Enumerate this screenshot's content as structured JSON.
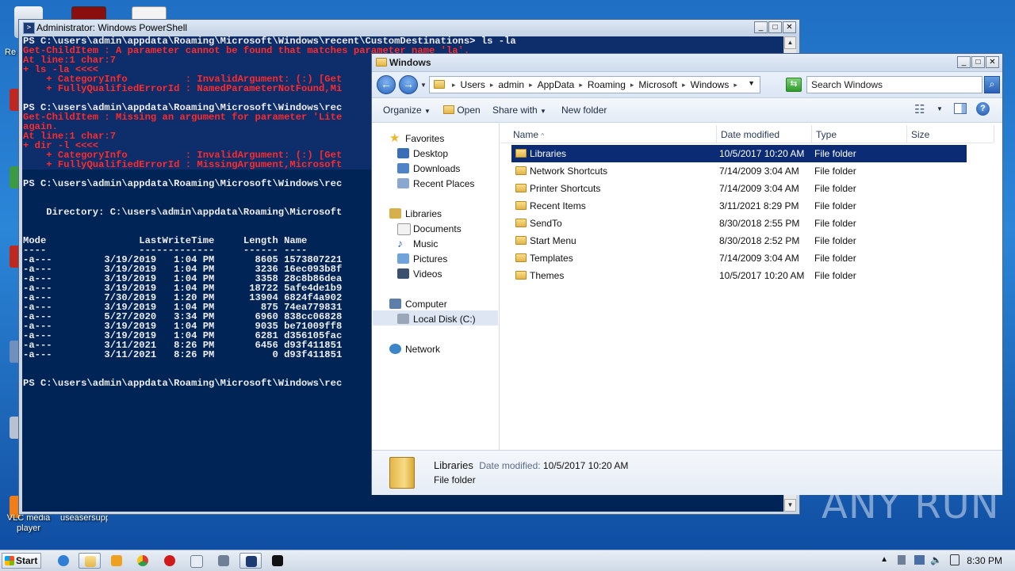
{
  "desktop": {
    "icons": [
      {
        "label": "Re"
      },
      {
        "label": "VLC media player"
      },
      {
        "label": "useasersuppor"
      }
    ],
    "watermark": "ANY RUN"
  },
  "powershell": {
    "title": "Administrator: Windows PowerShell",
    "lines": [
      {
        "text": "PS C:\\users\\admin\\appdata\\Roaming\\Microsoft\\Windows\\recent\\CustomDestinations> ls -la",
        "style": "sel"
      },
      {
        "text": "Get-ChildItem : A parameter cannot be found that matches parameter name 'la'.",
        "style": "red sel"
      },
      {
        "text": "At line:1 char:7",
        "style": "red sel"
      },
      {
        "text": "+ ls -la <<<<",
        "style": "red sel"
      },
      {
        "text": "    + CategoryInfo          : InvalidArgument: (:) [Get",
        "style": "red sel"
      },
      {
        "text": "    + FullyQualifiedErrorId : NamedParameterNotFound,Mi",
        "style": "red sel"
      },
      {
        "text": "",
        "style": "sel"
      },
      {
        "text": "PS C:\\users\\admin\\appdata\\Roaming\\Microsoft\\Windows\\rec",
        "style": "sel"
      },
      {
        "text": "Get-ChildItem : Missing an argument for parameter 'Lite",
        "style": "red sel"
      },
      {
        "text": "again.",
        "style": "red sel"
      },
      {
        "text": "At line:1 char:7",
        "style": "red sel"
      },
      {
        "text": "+ dir -l <<<<",
        "style": "red sel"
      },
      {
        "text": "    + CategoryInfo          : InvalidArgument: (:) [Get",
        "style": "red sel"
      },
      {
        "text": "    + FullyQualifiedErrorId : MissingArgument,Microsoft",
        "style": "red sel"
      },
      {
        "text": "",
        "style": ""
      },
      {
        "text": "PS C:\\users\\admin\\appdata\\Roaming\\Microsoft\\Windows\\rec",
        "style": ""
      },
      {
        "text": "",
        "style": ""
      },
      {
        "text": "",
        "style": ""
      },
      {
        "text": "    Directory: C:\\users\\admin\\appdata\\Roaming\\Microsoft",
        "style": ""
      },
      {
        "text": "",
        "style": ""
      },
      {
        "text": "",
        "style": ""
      },
      {
        "text": "Mode                LastWriteTime     Length Name",
        "style": ""
      },
      {
        "text": "----                -------------     ------ ----",
        "style": ""
      },
      {
        "text": "-a---         3/19/2019   1:04 PM       8605 1573807221",
        "style": ""
      },
      {
        "text": "-a---         3/19/2019   1:04 PM       3236 16ec093b8f",
        "style": ""
      },
      {
        "text": "-a---         3/19/2019   1:04 PM       3358 28c8b86dea",
        "style": ""
      },
      {
        "text": "-a---         3/19/2019   1:04 PM      18722 5afe4de1b9",
        "style": ""
      },
      {
        "text": "-a---         7/30/2019   1:20 PM      13904 6824f4a902",
        "style": ""
      },
      {
        "text": "-a---         3/19/2019   1:04 PM        875 74ea779831",
        "style": ""
      },
      {
        "text": "-a---         5/27/2020   3:34 PM       6960 838cc06828",
        "style": ""
      },
      {
        "text": "-a---         3/19/2019   1:04 PM       9035 be71009ff8",
        "style": ""
      },
      {
        "text": "-a---         3/19/2019   1:04 PM       6281 d356105fac",
        "style": ""
      },
      {
        "text": "-a---         3/11/2021   8:26 PM       6456 d93f411851",
        "style": ""
      },
      {
        "text": "-a---         3/11/2021   8:26 PM          0 d93f411851",
        "style": ""
      },
      {
        "text": "",
        "style": ""
      },
      {
        "text": "",
        "style": ""
      },
      {
        "text": "PS C:\\users\\admin\\appdata\\Roaming\\Microsoft\\Windows\\rec",
        "style": ""
      }
    ]
  },
  "explorer": {
    "title": "Windows",
    "breadcrumbs": [
      "Users",
      "admin",
      "AppData",
      "Roaming",
      "Microsoft",
      "Windows"
    ],
    "search_placeholder": "Search Windows",
    "commands": {
      "organize": "Organize",
      "open": "Open",
      "share_with": "Share with",
      "new_folder": "New folder"
    },
    "nav": {
      "favorites": "Favorites",
      "desktop": "Desktop",
      "downloads": "Downloads",
      "recent_places": "Recent Places",
      "libraries": "Libraries",
      "documents": "Documents",
      "music": "Music",
      "pictures": "Pictures",
      "videos": "Videos",
      "computer": "Computer",
      "local_disk": "Local Disk (C:)",
      "network": "Network"
    },
    "columns": {
      "name": "Name",
      "date": "Date modified",
      "type": "Type",
      "size": "Size"
    },
    "files": [
      {
        "name": "Libraries",
        "date": "10/5/2017 10:20 AM",
        "type": "File folder"
      },
      {
        "name": "Network Shortcuts",
        "date": "7/14/2009 3:04 AM",
        "type": "File folder"
      },
      {
        "name": "Printer Shortcuts",
        "date": "7/14/2009 3:04 AM",
        "type": "File folder"
      },
      {
        "name": "Recent Items",
        "date": "3/11/2021 8:29 PM",
        "type": "File folder"
      },
      {
        "name": "SendTo",
        "date": "8/30/2018 2:55 PM",
        "type": "File folder"
      },
      {
        "name": "Start Menu",
        "date": "8/30/2018 2:52 PM",
        "type": "File folder"
      },
      {
        "name": "Templates",
        "date": "7/14/2009 3:04 AM",
        "type": "File folder"
      },
      {
        "name": "Themes",
        "date": "10/5/2017 10:20 AM",
        "type": "File folder"
      }
    ],
    "details": {
      "name": "Libraries",
      "date_label": "Date modified:",
      "date": "10/5/2017 10:20 AM",
      "type": "File folder"
    }
  },
  "taskbar": {
    "start_label": "Start",
    "clock": "8:30 PM"
  },
  "colors": {
    "console_bg": "#012456",
    "error_text": "#ff2a2a",
    "selection": "#0b2c74"
  }
}
